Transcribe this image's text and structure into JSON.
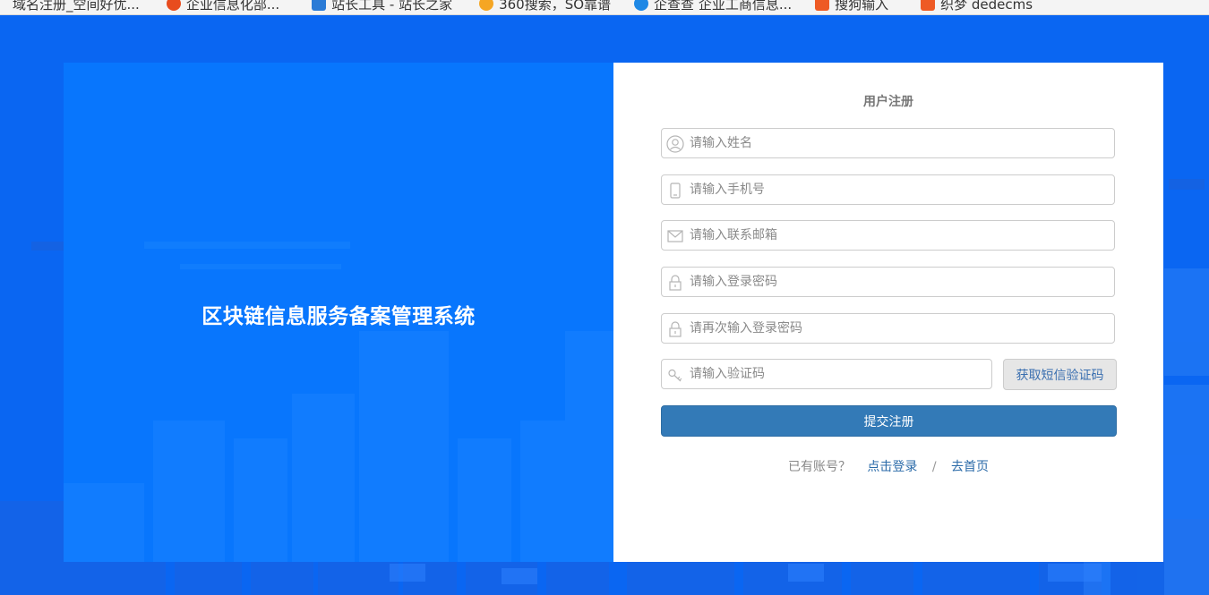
{
  "bookmarks": [
    {
      "label": "域名注册_空间好优...",
      "icon": "bookmark-icon",
      "color": "#ffffff"
    },
    {
      "label": "企业信息化部...",
      "icon": "virus-icon",
      "color": "#e84c1e"
    },
    {
      "label": "站长工具 - 站长之家",
      "icon": "tool-icon",
      "color": "#2b7bd6"
    },
    {
      "label": "360搜索，SO靠谱",
      "icon": "360-icon",
      "color": "#f5a623"
    },
    {
      "label": "企查查 企业工商信息...",
      "icon": "qichacha-icon",
      "color": "#1e88e5"
    },
    {
      "label": "搜狗输入",
      "icon": "sogou-icon",
      "color": "#ee5a24"
    },
    {
      "label": "织梦 dedecms",
      "icon": "dede-icon",
      "color": "#ee5a24"
    }
  ],
  "system_title": "区块链信息服务备案管理系统",
  "form": {
    "title": "用户注册",
    "fields": [
      {
        "placeholder": "请输入姓名",
        "value": "",
        "icon": "user-icon"
      },
      {
        "placeholder": "请输入手机号",
        "value": "",
        "icon": "phone-icon"
      },
      {
        "placeholder": "请输入联系邮箱",
        "value": "",
        "icon": "mail-icon"
      },
      {
        "placeholder": "请输入登录密码",
        "value": "",
        "icon": "lock-icon"
      },
      {
        "placeholder": "请再次输入登录密码",
        "value": "",
        "icon": "lock-icon"
      },
      {
        "placeholder": "请输入验证码",
        "value": "",
        "icon": "key-icon"
      }
    ],
    "sms_button": "获取短信验证码",
    "submit_button": "提交注册",
    "footer": {
      "question": "已有账号？",
      "login_link": "点击登录",
      "separator": "/",
      "home_link": "去首页"
    }
  },
  "colors": {
    "background": "#0a66f2",
    "left_panel": "#0876fd",
    "submit": "#337ab7",
    "link": "#2a6aa8"
  }
}
